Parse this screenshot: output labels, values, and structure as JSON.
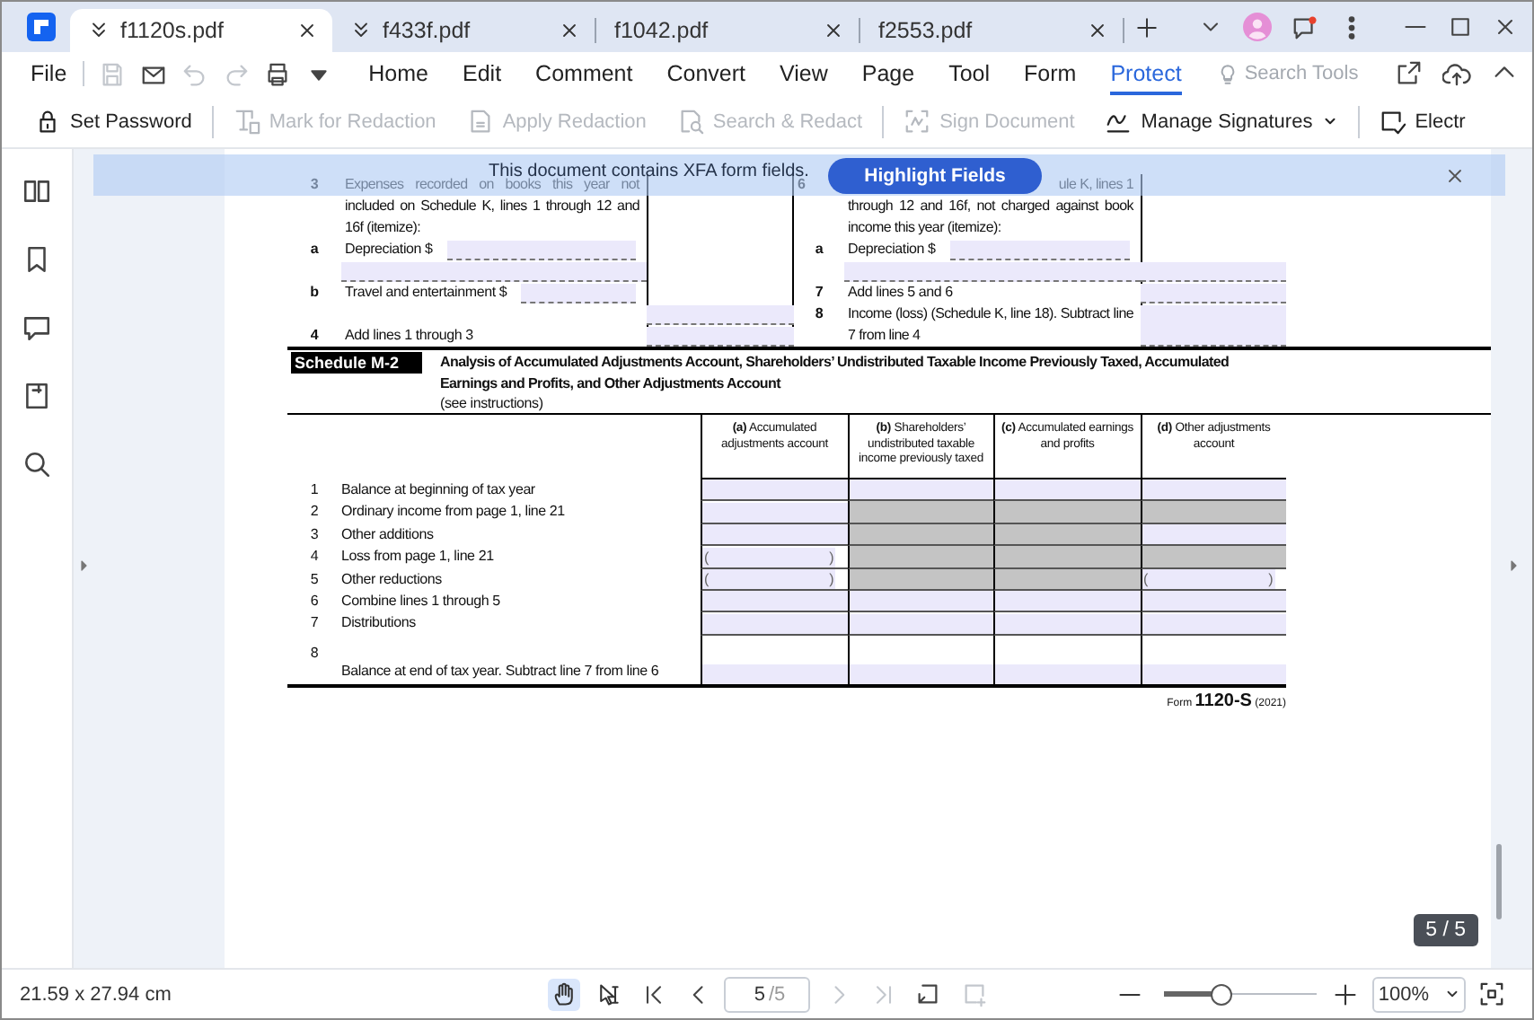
{
  "tabs": [
    {
      "label": "f1120s.pdf",
      "selected": true,
      "collapse_icon": true
    },
    {
      "label": "f433f.pdf",
      "selected": false,
      "collapse_icon": true
    },
    {
      "label": "f1042.pdf",
      "selected": false,
      "collapse_icon": false
    },
    {
      "label": "f2553.pdf",
      "selected": false,
      "collapse_icon": false
    }
  ],
  "menu_bar": {
    "file": "File",
    "quick_actions": [
      {
        "kind": "save",
        "disabled": true
      },
      {
        "kind": "mail",
        "disabled": false
      },
      {
        "kind": "undo",
        "disabled": true
      },
      {
        "kind": "redo",
        "disabled": true
      },
      {
        "kind": "print",
        "disabled": false
      },
      {
        "kind": "more",
        "disabled": false
      }
    ],
    "items": [
      {
        "label": "Home",
        "selected": false
      },
      {
        "label": "Edit",
        "selected": false
      },
      {
        "label": "Comment",
        "selected": false
      },
      {
        "label": "Convert",
        "selected": false
      },
      {
        "label": "View",
        "selected": false
      },
      {
        "label": "Page",
        "selected": false
      },
      {
        "label": "Tool",
        "selected": false
      },
      {
        "label": "Form",
        "selected": false
      },
      {
        "label": "Protect",
        "selected": true
      }
    ],
    "search": {
      "placeholder": "Search Tools"
    }
  },
  "toolbar": [
    {
      "kind": "lock",
      "label": "Set Password",
      "disabled": false,
      "dropdown": false
    },
    {
      "kind": "divider"
    },
    {
      "kind": "mark",
      "label": "Mark for Redaction",
      "disabled": true,
      "dropdown": false
    },
    {
      "kind": "apply",
      "label": "Apply Redaction",
      "disabled": true,
      "dropdown": false
    },
    {
      "kind": "search",
      "label": "Search & Redact",
      "disabled": true,
      "dropdown": false
    },
    {
      "kind": "divider"
    },
    {
      "kind": "sign",
      "label": "Sign Document",
      "disabled": true,
      "dropdown": false
    },
    {
      "kind": "signatures",
      "label": "Manage Signatures",
      "disabled": false,
      "dropdown": true
    },
    {
      "kind": "divider"
    },
    {
      "kind": "esign",
      "label": "Electr",
      "disabled": false,
      "dropdown": false
    }
  ],
  "banner": {
    "message": "This document contains XFA form fields.",
    "button": "Highlight Fields"
  },
  "form_top": {
    "left": [
      {
        "kind": "paragraph",
        "number": "3",
        "text": "Expenses recorded on books this year not included on Schedule K, lines 1 through 12 and 16f (itemize):"
      },
      {
        "kind": "entry",
        "number": "a",
        "text": "Depreciation $"
      },
      {
        "kind": "entry",
        "number": "b",
        "text": "Travel and entertainment $"
      },
      {
        "kind": "line",
        "number": "4",
        "text": "Add lines 1 through 3"
      }
    ],
    "right": [
      {
        "kind": "paragraph",
        "number": "6",
        "lead": "ule K, lines 1",
        "text": "through 12 and 16f, not charged against book income this year (itemize):"
      },
      {
        "kind": "entry",
        "number": "a",
        "text": "Depreciation $"
      },
      {
        "kind": "line",
        "number": "7",
        "text": "Add lines 5 and 6"
      },
      {
        "kind": "paragraph",
        "number": "8",
        "text": "Income (loss) (Schedule K, line 18). Subtract line 7 from line 4"
      }
    ]
  },
  "schedule": {
    "badge": "Schedule M-2",
    "title": "Analysis of Accumulated Adjustments Account, Shareholders’ Undistributed Taxable Income Previously Taxed, Accumulated Earnings and Profits, and Other Adjustments Account",
    "note": "(see instructions)",
    "columns": [
      "**(a)** Accumulated adjustments account",
      "**(b)** Shareholders’ undistributed taxable income previously taxed",
      "**(c)** Accumulated earnings and profits",
      "**(d)** Other adjustments account"
    ],
    "rows": [
      {
        "number": "1",
        "label": "Balance at beginning of tax year",
        "cells": [
          {
            "kind": "field"
          },
          {
            "kind": "field"
          },
          {
            "kind": "field"
          },
          {
            "kind": "field"
          }
        ]
      },
      {
        "number": "2",
        "label": "Ordinary income from page 1, line 21",
        "cells": [
          {
            "kind": "field"
          },
          {
            "kind": "shaded"
          },
          {
            "kind": "shaded"
          },
          {
            "kind": "shaded"
          }
        ]
      },
      {
        "number": "3",
        "label": "Other additions",
        "cells": [
          {
            "kind": "field"
          },
          {
            "kind": "shaded"
          },
          {
            "kind": "shaded"
          },
          {
            "kind": "field"
          }
        ]
      },
      {
        "number": "4",
        "label": "Loss from page 1, line 21",
        "cells": [
          {
            "kind": "paren",
            "open": "(",
            "close": ")"
          },
          {
            "kind": "shaded"
          },
          {
            "kind": "shaded"
          },
          {
            "kind": "shaded"
          }
        ]
      },
      {
        "number": "5",
        "label": "Other reductions",
        "cells": [
          {
            "kind": "paren",
            "open": "(",
            "close": ")"
          },
          {
            "kind": "shaded"
          },
          {
            "kind": "shaded"
          },
          {
            "kind": "paren",
            "open": "(",
            "close": ")"
          }
        ]
      },
      {
        "number": "6",
        "label": "Combine lines 1 through 5",
        "cells": [
          {
            "kind": "field"
          },
          {
            "kind": "field"
          },
          {
            "kind": "field"
          },
          {
            "kind": "field"
          }
        ]
      },
      {
        "number": "7",
        "label": "Distributions",
        "cells": [
          {
            "kind": "field"
          },
          {
            "kind": "field"
          },
          {
            "kind": "field"
          },
          {
            "kind": "field"
          }
        ]
      },
      {
        "number": "8",
        "label": "Balance at end of tax year. Subtract line 7 from line 6",
        "cells": [
          {
            "kind": "field"
          },
          {
            "kind": "field"
          },
          {
            "kind": "field"
          },
          {
            "kind": "field"
          }
        ]
      }
    ],
    "footer": "Form **1120-S** (2021)"
  },
  "page_indicator": "5 / 5",
  "status_bar": {
    "page_size": "21.59 x 27.94 cm",
    "tools": [
      {
        "kind": "hand",
        "selected": true
      },
      {
        "kind": "select",
        "selected": false
      }
    ],
    "navigation": [
      {
        "kind": "first",
        "disabled": false
      },
      {
        "kind": "previous",
        "disabled": false
      },
      {
        "kind": "next",
        "disabled": true
      },
      {
        "kind": "last",
        "disabled": true
      }
    ],
    "page": "5",
    "page_count": "/5",
    "page_tools": [
      {
        "kind": "rotate",
        "disabled": false
      },
      {
        "kind": "extract",
        "disabled": true
      }
    ],
    "zoom": {
      "level": 0.38,
      "value": "100%"
    }
  }
}
